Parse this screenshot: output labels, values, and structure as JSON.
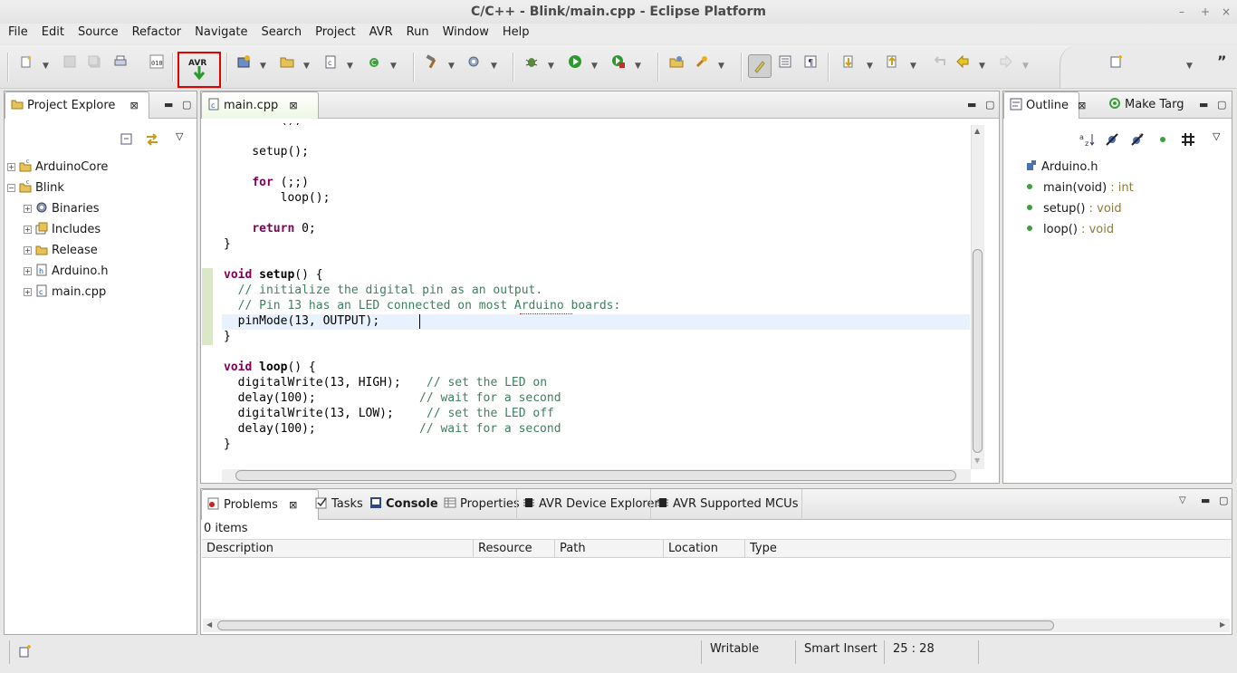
{
  "window": {
    "title": "C/C++ - Blink/main.cpp - Eclipse Platform",
    "minimize_glyph": "–",
    "maximize_glyph": "+",
    "close_glyph": "×"
  },
  "menu": [
    "File",
    "Edit",
    "Source",
    "Refactor",
    "Navigate",
    "Search",
    "Project",
    "AVR",
    "Run",
    "Window",
    "Help"
  ],
  "toolbar": {
    "highlight_color": "#e60000",
    "avr_upload_label": "AVR",
    "overflow_glyph": "”"
  },
  "project_explorer": {
    "tab_label": "Project Explore",
    "tree": [
      {
        "label": "ArduinoCore",
        "expander": "+",
        "icon": "project-folder-icon"
      },
      {
        "label": "Blink",
        "expander": "−",
        "icon": "project-folder-icon"
      },
      {
        "label": "Binaries",
        "expander": "+",
        "icon": "binaries-icon"
      },
      {
        "label": "Includes",
        "expander": "+",
        "icon": "includes-icon"
      },
      {
        "label": "Release",
        "expander": "+",
        "icon": "folder-icon"
      },
      {
        "label": "Arduino.h",
        "expander": "+",
        "icon": "header-file-icon"
      },
      {
        "label": "main.cpp",
        "expander": "+",
        "icon": "cpp-file-icon"
      }
    ]
  },
  "editor": {
    "tab_label": "main.cpp",
    "lines": {
      "l0": "    init();",
      "l1a": "    setup();",
      "l2kw": "for",
      "l2": " (;;)",
      "l3": "        loop();",
      "l4kw": "return",
      "l4": " 0;",
      "l5": "}",
      "l6kw": "void",
      "l6fn": "setup",
      "l6": "() {",
      "l7": "  // initialize the digital pin as an output.",
      "l8": "  // Pin 13 has an LED connected on most Arduino boards:",
      "l9": "  pinMode(13, OUTPUT);",
      "l10": "}",
      "l11kw": "void",
      "l11fn": "loop",
      "l11": "() {",
      "l12": "  digitalWrite(13, HIGH);",
      "l12c": "// set the LED on",
      "l13": "  delay(100);",
      "l13c": "// wait for a second",
      "l14": "  digitalWrite(13, LOW);",
      "l14c": "// set the LED off",
      "l15": "  delay(100);",
      "l15c": "// wait for a second",
      "l16": "}"
    }
  },
  "outline": {
    "tab_label": "Outline",
    "tab2_label": "Make Targ",
    "items": [
      {
        "name": "Arduino.h",
        "type": ""
      },
      {
        "name": "main(void)",
        "type": " : int"
      },
      {
        "name": "setup()",
        "type": " : void"
      },
      {
        "name": "loop()",
        "type": " : void"
      }
    ]
  },
  "bottom": {
    "tabs": [
      "Problems",
      "Tasks",
      "Console",
      "Properties",
      "AVR Device Explorer",
      "AVR Supported MCUs"
    ],
    "item_count": "0 items",
    "columns": [
      "Description",
      "Resource",
      "Path",
      "Location",
      "Type"
    ]
  },
  "status": {
    "writable": "Writable",
    "insert_mode": "Smart Insert",
    "position": "25 : 28"
  }
}
